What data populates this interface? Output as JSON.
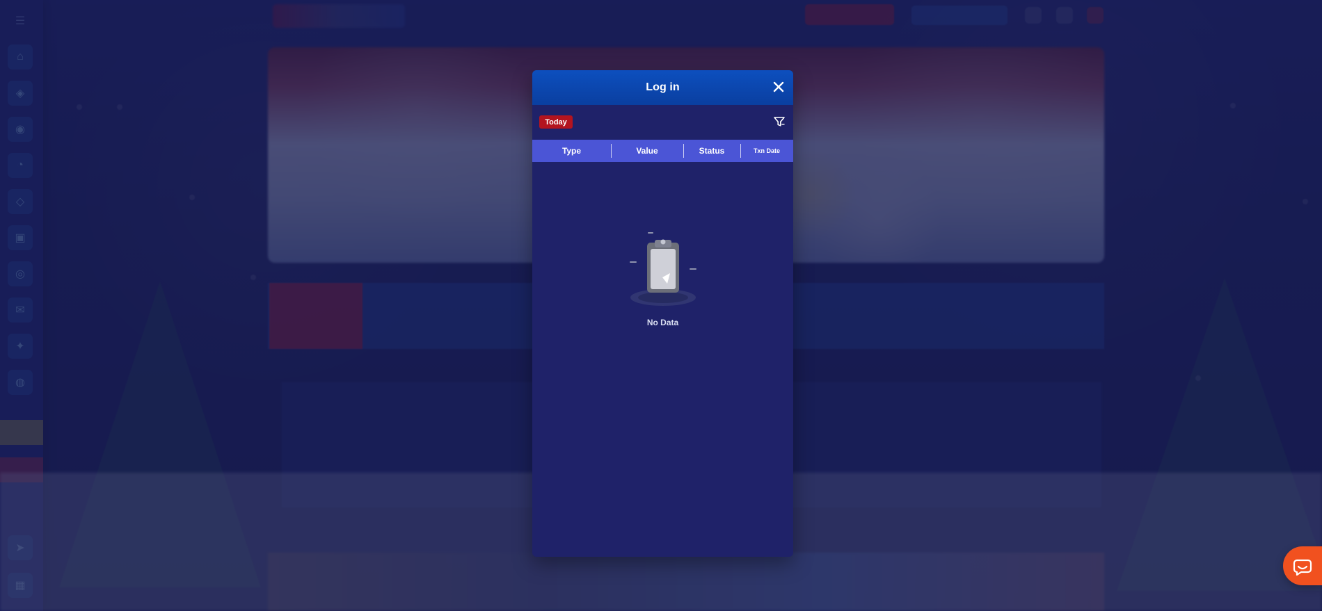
{
  "modal": {
    "title": "Log in",
    "filter_badge": "Today",
    "columns": [
      "Type",
      "Value",
      "Status",
      "Txn Date"
    ],
    "empty_text": "No Data"
  },
  "icons": {
    "close": "close-icon",
    "filter": "filter-icon",
    "empty": "clipboard-icon",
    "chat": "chat-icon"
  },
  "colors": {
    "modal_header": "#0d4fbe",
    "modal_body": "#1f2269",
    "table_header": "#4b55d6",
    "today_badge": "#b3141f",
    "chat_launcher": "#f1511f"
  }
}
